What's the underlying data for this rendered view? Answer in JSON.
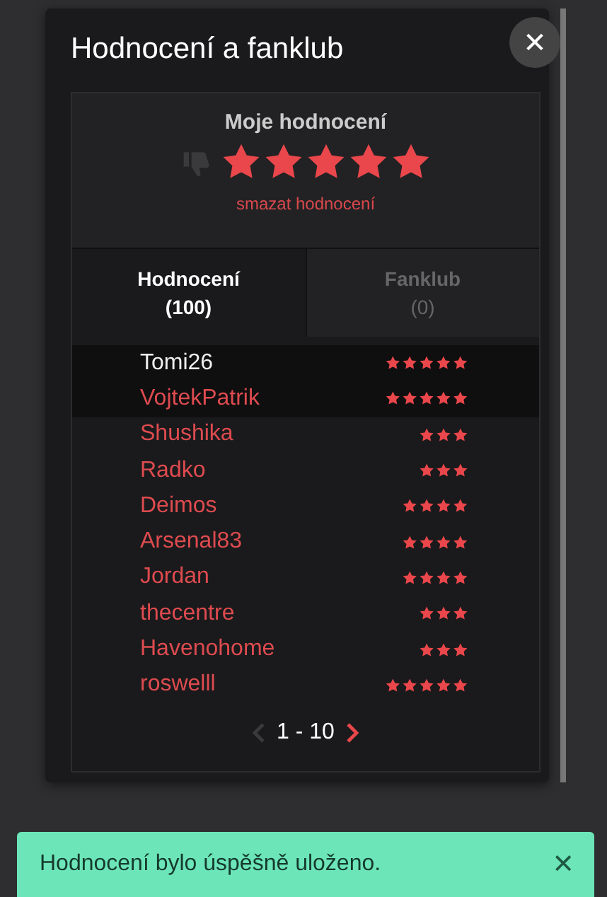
{
  "dialog": {
    "title": "Hodnocení a fanklub",
    "close": "✕"
  },
  "my_rating": {
    "heading": "Moje hodnocení",
    "stars": 5,
    "delete_link": "smazat hodnocení"
  },
  "tabs": [
    {
      "label": "Hodnocení",
      "count": "(100)",
      "selected": true
    },
    {
      "label": "Fanklub",
      "count": "(0)",
      "selected": false
    }
  ],
  "ratings": [
    {
      "user": "Tomi26",
      "stars": 5,
      "own": true,
      "highlighted": true
    },
    {
      "user": "VojtekPatrik",
      "stars": 5,
      "own": false,
      "highlighted": true
    },
    {
      "user": "Shushika",
      "stars": 3,
      "own": false,
      "highlighted": false
    },
    {
      "user": "Radko",
      "stars": 3,
      "own": false,
      "highlighted": false
    },
    {
      "user": "Deimos",
      "stars": 4,
      "own": false,
      "highlighted": false
    },
    {
      "user": "Arsenal83",
      "stars": 4,
      "own": false,
      "highlighted": false
    },
    {
      "user": "Jordan",
      "stars": 4,
      "own": false,
      "highlighted": false
    },
    {
      "user": "thecentre",
      "stars": 3,
      "own": false,
      "highlighted": false
    },
    {
      "user": "Havenohome",
      "stars": 3,
      "own": false,
      "highlighted": false
    },
    {
      "user": "roswelll",
      "stars": 5,
      "own": false,
      "highlighted": false
    }
  ],
  "pagination": {
    "range": "1 - 10",
    "prev_disabled": true,
    "next_disabled": false
  },
  "toast": {
    "message": "Hodnocení bylo úspěšně uloženo.",
    "close": "✕"
  }
}
